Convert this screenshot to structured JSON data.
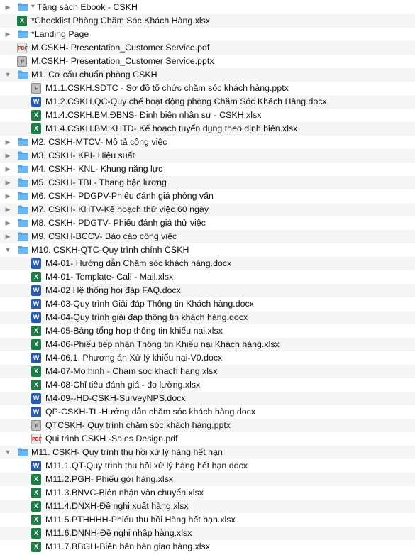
{
  "items": [
    {
      "label": "* Tặng sách Ebook - CSKH",
      "type": "folder",
      "expanded": false,
      "level": 0
    },
    {
      "label": "*Checklist Phòng Chăm Sóc Khách Hàng.xlsx",
      "type": "xlsx",
      "level": 0
    },
    {
      "label": "*Landing Page",
      "type": "folder",
      "expanded": false,
      "level": 0
    },
    {
      "label": "M.CSKH- Presentation_Customer Service.pdf",
      "type": "pdf",
      "level": 0
    },
    {
      "label": "M.CSKH- Presentation_Customer Service.pptx",
      "type": "pptx",
      "level": 0
    },
    {
      "label": "M1. Cơ cấu chuẩn phòng CSKH",
      "type": "folder",
      "expanded": true,
      "level": 0
    },
    {
      "label": "M1.1.CSKH.SDTC - Sơ đồ tổ chức chăm sóc khách hàng.pptx",
      "type": "pptx",
      "level": 1
    },
    {
      "label": "M1.2.CSKH.QC-Quy chế hoạt động phòng Chăm Sóc Khách Hàng.docx",
      "type": "docx",
      "level": 1
    },
    {
      "label": "M1.4.CSKH.BM.ĐBNS- Định biên nhân sự - CSKH.xlsx",
      "type": "xlsx",
      "level": 1
    },
    {
      "label": "M1.4.CSKH.BM.KHTD- Kế hoạch tuyển dụng theo định biên.xlsx",
      "type": "xlsx",
      "level": 1
    },
    {
      "label": "M2. CSKH-MTCV- Mô tả công việc",
      "type": "folder",
      "expanded": false,
      "level": 0
    },
    {
      "label": "M3. CSKH- KPI- Hiệu suất",
      "type": "folder",
      "expanded": false,
      "level": 0
    },
    {
      "label": "M4. CSKH- KNL- Khung năng lực",
      "type": "folder",
      "expanded": false,
      "level": 0
    },
    {
      "label": "M5. CSKH- TBL- Thang bậc lương",
      "type": "folder",
      "expanded": false,
      "level": 0
    },
    {
      "label": "M6. CSKH- PDGPV-Phiếu đánh giá phỏng vấn",
      "type": "folder",
      "expanded": false,
      "level": 0
    },
    {
      "label": "M7. CSKH- KHTV-Kế hoạch thử việc 60 ngày",
      "type": "folder",
      "expanded": false,
      "level": 0
    },
    {
      "label": "M8. CSKH- PDGTV- Phiếu đánh giá thử việc",
      "type": "folder",
      "expanded": false,
      "level": 0
    },
    {
      "label": "M9. CSKH-BCCV- Báo cáo công việc",
      "type": "folder",
      "expanded": false,
      "level": 0
    },
    {
      "label": "M10. CSKH-QTC-Quy trình chính CSKH",
      "type": "folder",
      "expanded": true,
      "level": 0
    },
    {
      "label": "M4-01- Hướng dẫn Chăm sóc khách hàng.docx",
      "type": "docx",
      "level": 1
    },
    {
      "label": "M4-01- Template- Call - Mail.xlsx",
      "type": "xlsx",
      "level": 1
    },
    {
      "label": "M4-02 Hệ thống hỏi đáp FAQ.docx",
      "type": "docx",
      "level": 1
    },
    {
      "label": "M4-03-Quy trình Giải đáp Thông tin Khách hàng.docx",
      "type": "docx",
      "level": 1
    },
    {
      "label": "M4-04-Quy trình giải đáp thông tin khách hàng.docx",
      "type": "docx",
      "level": 1
    },
    {
      "label": "M4-05-Bảng tổng hợp thông tin khiếu nại.xlsx",
      "type": "xlsx",
      "level": 1
    },
    {
      "label": "M4-06-Phiếu tiếp nhận Thông tin Khiếu nại Khách hàng.xlsx",
      "type": "xlsx",
      "level": 1
    },
    {
      "label": "M4-06.1. Phương án Xử lý khiếu nại-V0.docx",
      "type": "docx",
      "level": 1
    },
    {
      "label": "M4-07-Mo hinh - Cham soc khach hang.xlsx",
      "type": "xlsx",
      "level": 1
    },
    {
      "label": "M4-08-Chỉ tiêu đánh giá - đo lường.xlsx",
      "type": "xlsx",
      "level": 1
    },
    {
      "label": "M4-09--HD-CSKH-SurveyNPS.docx",
      "type": "docx",
      "level": 1
    },
    {
      "label": "QP-CSKH-TL-Hướng dẫn chăm sóc khách hàng.docx",
      "type": "docx",
      "level": 1
    },
    {
      "label": "QTCSKH- Quy trình chăm sóc khách hàng.pptx",
      "type": "pptx",
      "level": 1
    },
    {
      "label": "Qui trình CSKH -Sales Design.pdf",
      "type": "pdf",
      "level": 1
    },
    {
      "label": "M11. CSKH- Quy trình thu hồi xử lý hàng hết hạn",
      "type": "folder",
      "expanded": true,
      "level": 0
    },
    {
      "label": "M11.1.QT-Quy trình thu hồi xử lý hàng hết hạn.docx",
      "type": "docx",
      "level": 1
    },
    {
      "label": "M11.2.PGH- Phiếu gởi hàng.xlsx",
      "type": "xlsx",
      "level": 1
    },
    {
      "label": "M11.3.BNVC-Biên  nhận vận chuyển.xlsx",
      "type": "xlsx",
      "level": 1
    },
    {
      "label": "M11.4.DNXH-Đề nghị xuất hàng.xlsx",
      "type": "xlsx",
      "level": 1
    },
    {
      "label": "M11.5.PTHHHH-Phiếu thu hồi Hàng hết hạn.xlsx",
      "type": "xlsx",
      "level": 1
    },
    {
      "label": "M11.6.DNNH-Đề nghị nhập hàng.xlsx",
      "type": "xlsx",
      "level": 1
    },
    {
      "label": "M11.7.BBGH-Biên bản bàn giao hàng.xlsx",
      "type": "xlsx",
      "level": 1
    }
  ],
  "icons": {
    "folder": "folder-icon",
    "xlsx": "excel-file-icon",
    "docx": "word-file-icon",
    "pptx": "powerpoint-file-icon",
    "pdf": "pdf-file-icon",
    "expanded": "disclosure-triangle-down-icon",
    "collapsed": "disclosure-triangle-right-icon"
  },
  "colors": {
    "folder": "#4ea6e8",
    "xlsx": "#1e7b45",
    "docx": "#2b5aa8",
    "row_alt": "#f4f5f5"
  }
}
